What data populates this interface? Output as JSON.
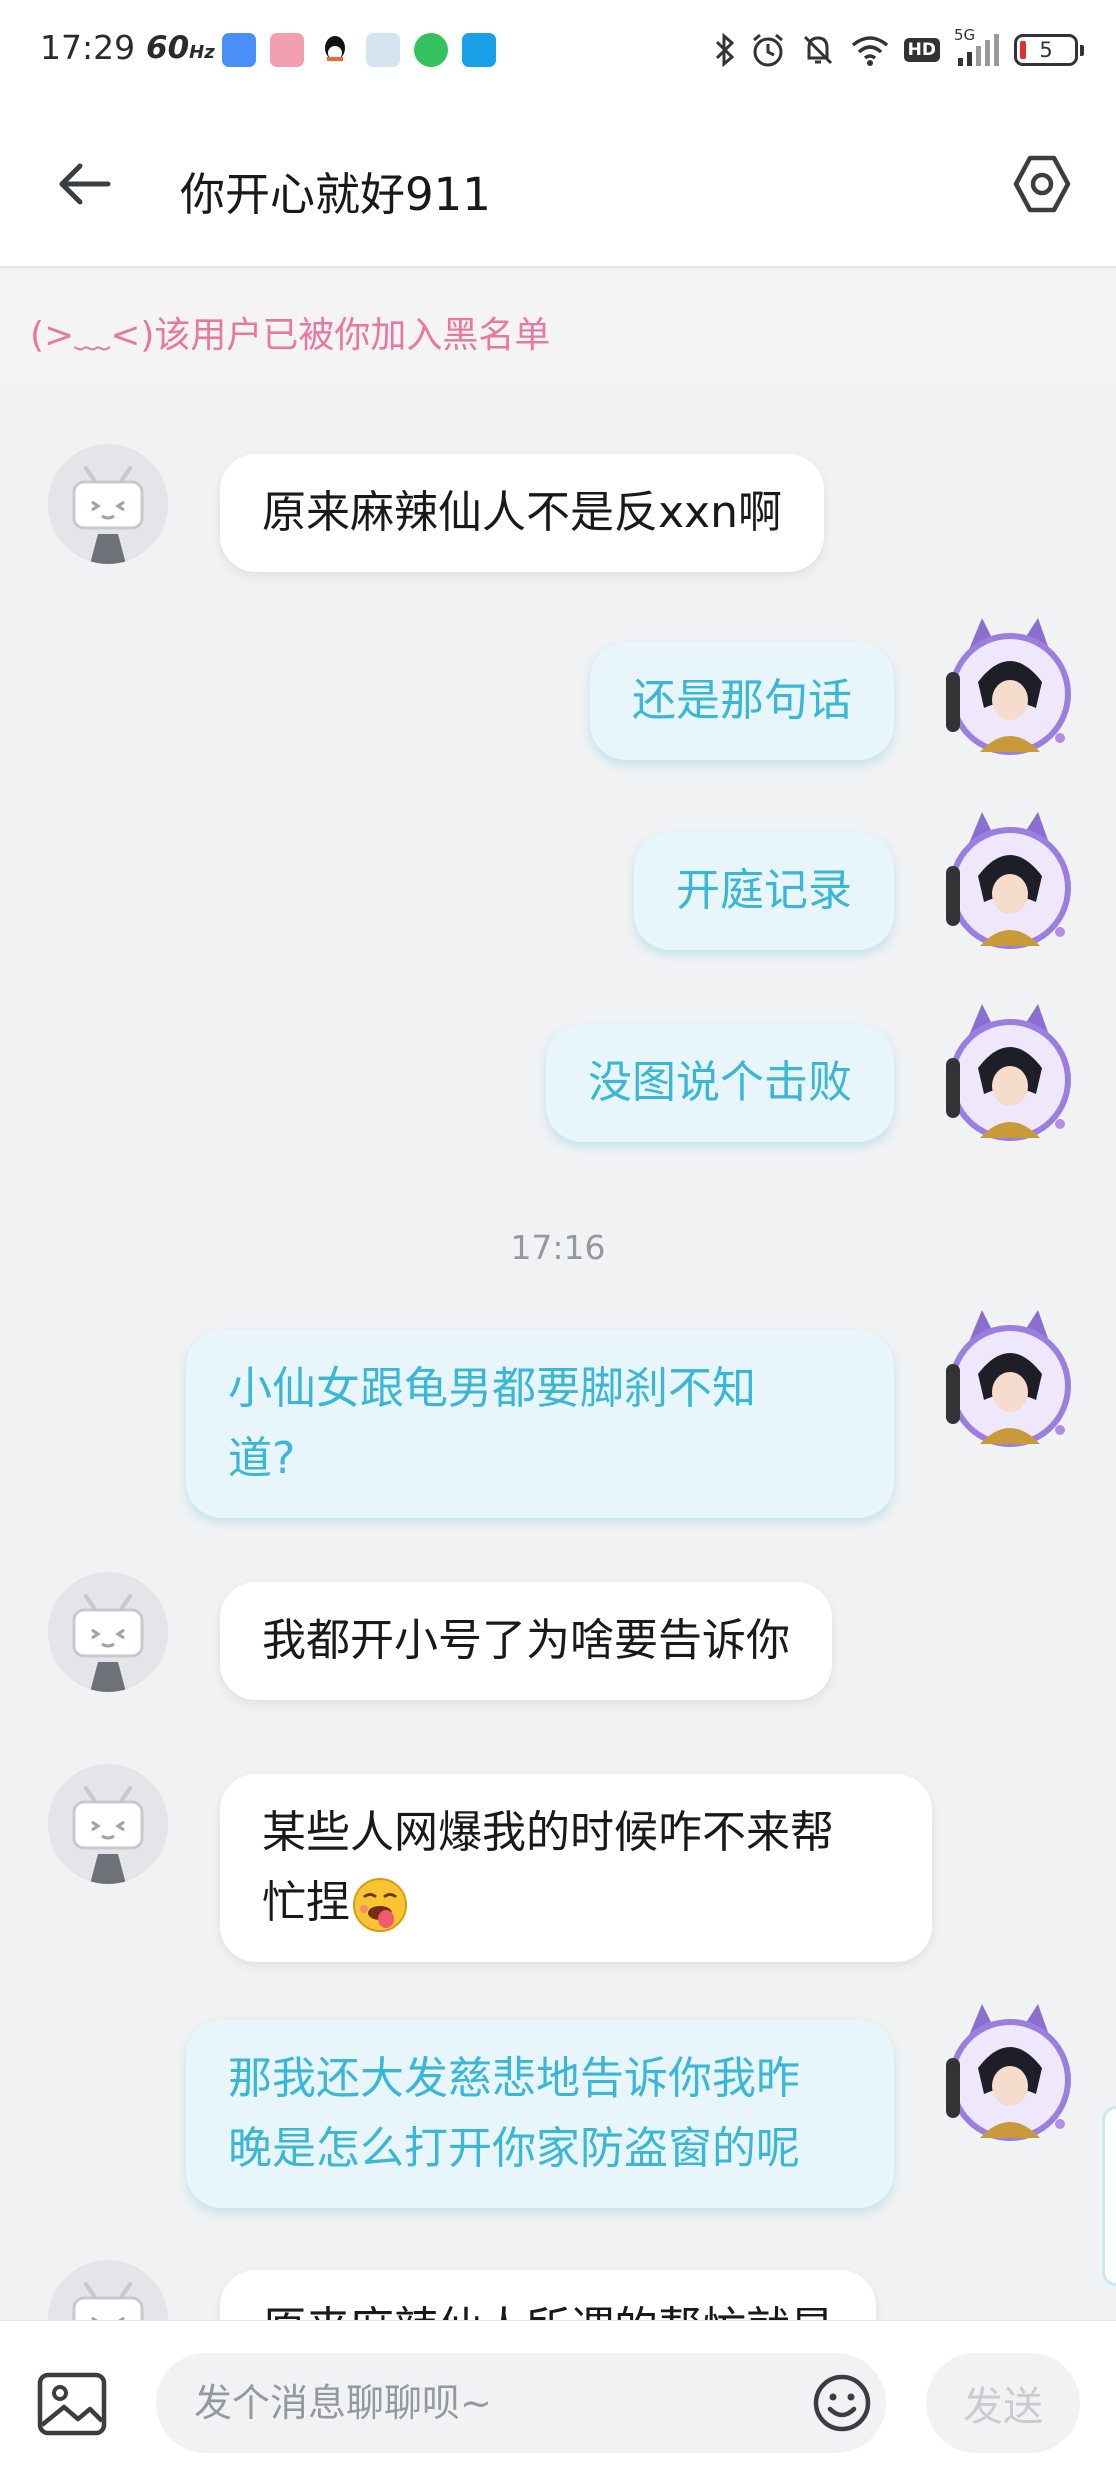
{
  "status_bar": {
    "time": "17:29",
    "refresh_rate": "60",
    "refresh_unit": "Hz",
    "network": "5G",
    "hd_badge": "HD",
    "battery_level": "5",
    "icons": [
      "bluetooth-icon",
      "alarm-icon",
      "mute-icon",
      "wifi-icon",
      "signal-icon"
    ],
    "app_icons": [
      "app-icon-1",
      "app-icon-2",
      "qq-icon",
      "app-icon-4",
      "message-app-icon",
      "app-icon-6"
    ]
  },
  "header": {
    "title": "你开心就好911",
    "back_icon": "arrow-left-icon",
    "settings_icon": "settings-icon"
  },
  "notice": {
    "text": "(>﹏<)该用户已被你加入黑名单"
  },
  "messages": [
    {
      "side": "in",
      "text": "原来麻辣仙人不是反xxn啊"
    },
    {
      "side": "out",
      "text": "还是那句话"
    },
    {
      "side": "out",
      "text": "开庭记录"
    },
    {
      "side": "out",
      "text": "没图说个击败"
    },
    {
      "type": "time",
      "text": "17:16"
    },
    {
      "side": "out",
      "lines": [
        "小仙女跟龟男都要脚刹不知",
        "道?"
      ]
    },
    {
      "side": "in",
      "text": "我都开小号了为啥要告诉你"
    },
    {
      "side": "in",
      "lines": [
        "某些人网爆我的时候咋不来帮",
        "忙捏"
      ],
      "emoji": "tongue-emoji"
    },
    {
      "side": "out",
      "lines": [
        "那我还大发慈悲地告诉你我昨",
        "晚是怎么打开你家防盗窗的呢"
      ]
    },
    {
      "side": "in",
      "text": "原来麻辣仙人所谓的帮忙就是"
    }
  ],
  "input_bar": {
    "placeholder": "发个消息聊聊呗~",
    "send_label": "发送",
    "image_icon": "image-icon",
    "emoji_icon": "smiley-icon"
  },
  "colors": {
    "outgoing_text": "#3ab6d6",
    "outgoing_bg": "#e8f6fc",
    "notice_text": "#e8799e",
    "background": "#f1f2f3"
  }
}
